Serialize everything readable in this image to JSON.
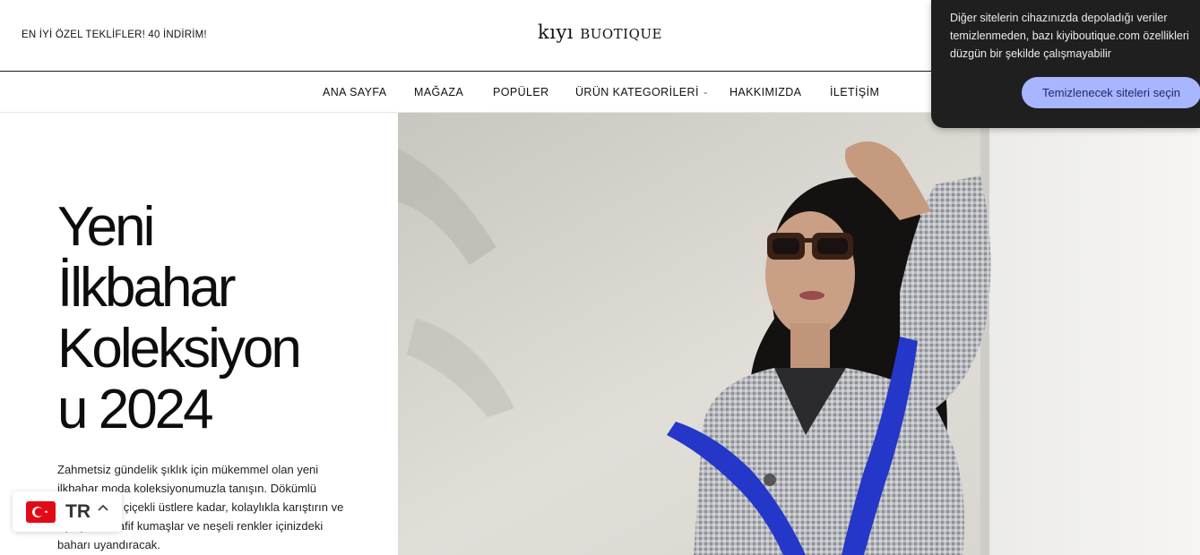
{
  "header": {
    "promo": "EN İYİ ÖZEL TEKLİFLER! 40 İNDİRİM!",
    "logo_first": "kıyı",
    "logo_second": "buotique"
  },
  "nav": {
    "items": [
      {
        "label": "ANA SAYFA"
      },
      {
        "label": "MAĞAZA"
      },
      {
        "label": "POPÜLER"
      },
      {
        "label": "ÜRÜN KATEGORİLERİ",
        "has_dropdown": true
      },
      {
        "label": "HAKKIMIZDA"
      },
      {
        "label": "İLETİŞİM"
      }
    ]
  },
  "hero": {
    "title_lines": [
      "Yeni",
      "İlkbahar",
      "Koleksiyon",
      "u 2024"
    ],
    "description": "Zahmetsiz gündelik şıklık için mükemmel olan yeni ilkbahar moda koleksiyonumuzla tanışın. Dökümlü elbiselerden çiçekli üstlere kadar, kolaylıkla karıştırın ve eşleştirin. Hafif kumaşlar ve neşeli renkler içinizdeki baharı uyandıracak."
  },
  "cookie": {
    "text": "Diğer sitelerin cihazınızda depoladığı veriler temizlenmeden, bazı kiyiboutique.com özellikleri düzgün bir şekilde çalışmayabilir",
    "button_label": "Temizlenecek siteleri seçin"
  },
  "language": {
    "code": "TR",
    "flag_icon": "turkey-flag-icon"
  },
  "colors": {
    "popup_bg": "#1f1f1f",
    "popup_button": "#a8b6ff",
    "flag_red": "#e30a17"
  }
}
